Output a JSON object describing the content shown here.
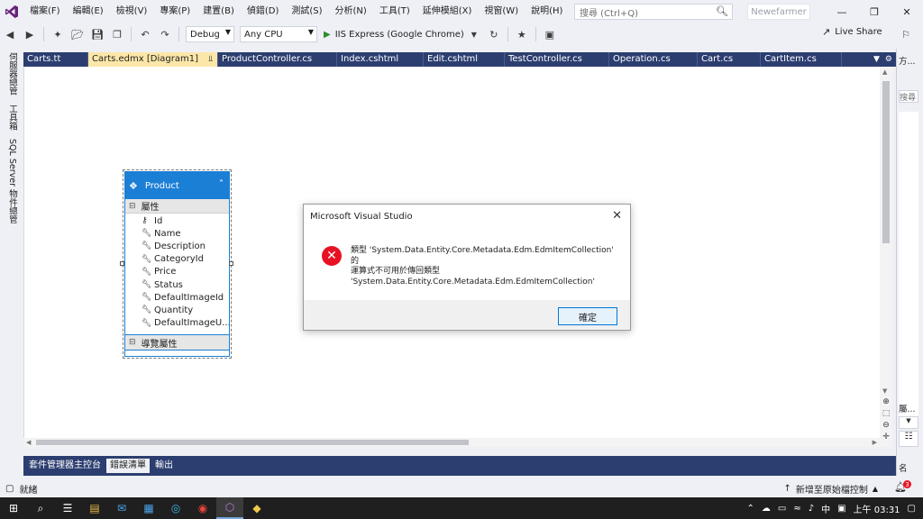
{
  "menu": {
    "items": [
      "檔案(F)",
      "編輯(E)",
      "檢視(V)",
      "專案(P)",
      "建置(B)",
      "偵錯(D)",
      "測試(S)",
      "分析(N)",
      "工具(T)",
      "延伸模組(X)",
      "視窗(W)",
      "說明(H)"
    ],
    "search_placeholder": "搜尋 (Ctrl+Q)",
    "user": "Newefarmer"
  },
  "toolbar": {
    "config": "Debug",
    "platform": "Any CPU",
    "run_label": "IIS Express (Google Chrome)",
    "live_share": "Live Share"
  },
  "left_strip": {
    "tabs": [
      "伺服器總管",
      "工具箱",
      "SQL Server 物件總管"
    ]
  },
  "tabs": [
    {
      "label": "Carts.tt",
      "active": false
    },
    {
      "label": "Carts.edmx [Diagram1]",
      "active": true
    },
    {
      "label": "ProductController.cs",
      "active": false
    },
    {
      "label": "Index.cshtml",
      "active": false
    },
    {
      "label": "Edit.cshtml",
      "active": false
    },
    {
      "label": "TestController.cs",
      "active": false
    },
    {
      "label": "Operation.cs",
      "active": false
    },
    {
      "label": "Cart.cs",
      "active": false
    },
    {
      "label": "CartItem.cs",
      "active": false
    }
  ],
  "entity": {
    "name": "Product",
    "props_header": "屬性",
    "nav_header": "導覽屬性",
    "properties": [
      "Id",
      "Name",
      "Description",
      "CategoryId",
      "Price",
      "Status",
      "DefaultImageId",
      "Quantity",
      "DefaultImageU..."
    ]
  },
  "dialog": {
    "title": "Microsoft Visual Studio",
    "message_line1": "類型 'System.Data.Entity.Core.Metadata.Edm.EdmItemCollection' 的",
    "message_line2": "運算式不可用於傳回類型",
    "message_line3": "'System.Data.Entity.Core.Metadata.Edm.EdmItemCollection'",
    "ok": "確定"
  },
  "right_panel": {
    "tab_top": "方...",
    "search": "搜尋",
    "tab_bottom": "屬...",
    "name_label": "名"
  },
  "bottom_tabs": [
    {
      "label": "套件管理器主控台",
      "active": false
    },
    {
      "label": "錯誤清單",
      "active": true
    },
    {
      "label": "輸出",
      "active": false
    }
  ],
  "status": {
    "ready": "就緒",
    "source_control": "新增至原始檔控制",
    "notifications": "3"
  },
  "taskbar": {
    "ime": "中",
    "time": "上午 03:31"
  }
}
